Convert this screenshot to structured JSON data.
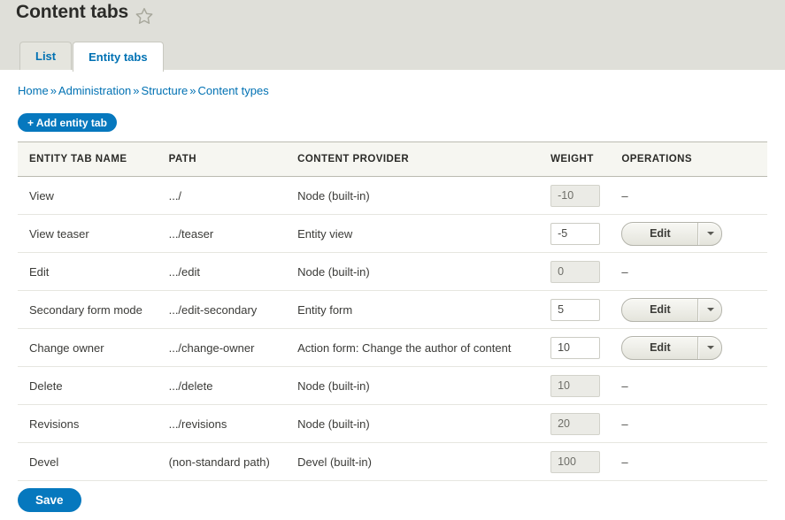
{
  "header": {
    "title": "Content tabs",
    "star_icon": "star-outline-icon"
  },
  "tabs": [
    {
      "label": "List",
      "active": false
    },
    {
      "label": "Entity tabs",
      "active": true
    }
  ],
  "breadcrumb": {
    "separator": "»",
    "items": [
      "Home",
      "Administration",
      "Structure",
      "Content types"
    ]
  },
  "actions": {
    "add_entity_tab_label": "+ Add entity tab",
    "save_label": "Save"
  },
  "table": {
    "columns": [
      "ENTITY TAB NAME",
      "PATH",
      "CONTENT PROVIDER",
      "WEIGHT",
      "OPERATIONS"
    ],
    "rows": [
      {
        "name": "View",
        "path": ".../",
        "provider": "Node (built-in)",
        "weight": "-10",
        "weight_disabled": true,
        "operation": "dash",
        "operation_label": "–"
      },
      {
        "name": "View teaser",
        "path": ".../teaser",
        "provider": "Entity view",
        "weight": "-5",
        "weight_disabled": false,
        "operation": "dropbutton",
        "operation_label": "Edit"
      },
      {
        "name": "Edit",
        "path": ".../edit",
        "provider": "Node (built-in)",
        "weight": "0",
        "weight_disabled": true,
        "operation": "dash",
        "operation_label": "–"
      },
      {
        "name": "Secondary form mode",
        "path": ".../edit-secondary",
        "provider": "Entity form",
        "weight": "5",
        "weight_disabled": false,
        "operation": "dropbutton",
        "operation_label": "Edit"
      },
      {
        "name": "Change owner",
        "path": ".../change-owner",
        "provider": "Action form: Change the author of content",
        "weight": "10",
        "weight_disabled": false,
        "operation": "dropbutton",
        "operation_label": "Edit"
      },
      {
        "name": "Delete",
        "path": ".../delete",
        "provider": "Node (built-in)",
        "weight": "10",
        "weight_disabled": true,
        "operation": "dash",
        "operation_label": "–"
      },
      {
        "name": "Revisions",
        "path": ".../revisions",
        "provider": "Node (built-in)",
        "weight": "20",
        "weight_disabled": true,
        "operation": "dash",
        "operation_label": "–"
      },
      {
        "name": "Devel",
        "path": "(non-standard path)",
        "provider": "Devel (built-in)",
        "weight": "100",
        "weight_disabled": true,
        "operation": "dash",
        "operation_label": "–"
      }
    ]
  },
  "colors": {
    "header_band": "#dfdfd9",
    "link": "#0071b3",
    "primary_button": "#0678be",
    "table_head_bg": "#f6f6f1"
  }
}
